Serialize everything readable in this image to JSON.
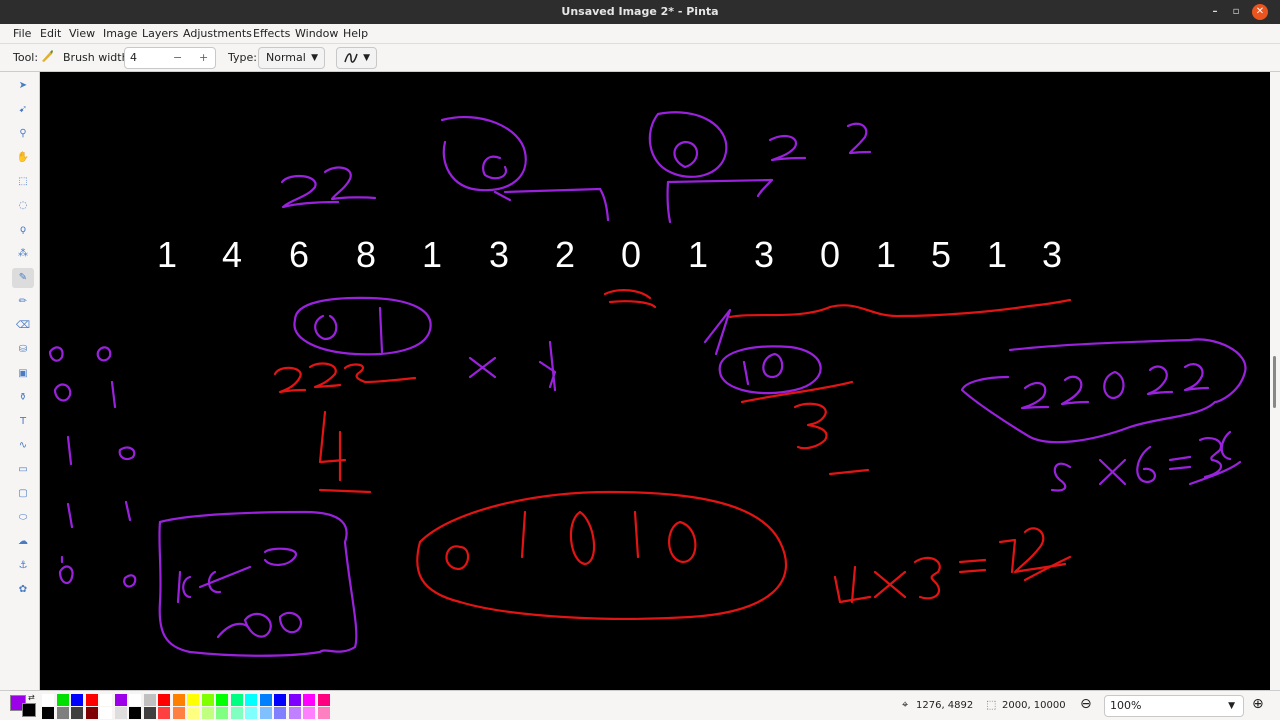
{
  "window": {
    "title": "Unsaved Image 2* - Pinta"
  },
  "menu": {
    "items": [
      "File",
      "Edit",
      "View",
      "Image",
      "Layers",
      "Adjustments",
      "Effects",
      "Window",
      "Help"
    ]
  },
  "toolbar": {
    "tool_label": "Tool:",
    "brush_width_label": "Brush width:",
    "brush_width_value": "4",
    "minus_label": "−",
    "plus_label": "+",
    "type_label": "Type:",
    "type_value": "Normal"
  },
  "tools": [
    {
      "name": "move-selected-tool",
      "icon": "arrow-icon"
    },
    {
      "name": "move-selection-tool",
      "icon": "arrow-plus-icon"
    },
    {
      "name": "zoom-tool",
      "icon": "magnifier-icon"
    },
    {
      "name": "pan-tool",
      "icon": "hand-icon"
    },
    {
      "name": "rectangle-select-tool",
      "icon": "dotted-rectangle-icon"
    },
    {
      "name": "ellipse-select-tool",
      "icon": "dotted-ellipse-icon"
    },
    {
      "name": "lasso-select-tool",
      "icon": "lasso-icon"
    },
    {
      "name": "magic-wand-tool",
      "icon": "wand-icon"
    },
    {
      "name": "paintbrush-tool",
      "icon": "brush-icon",
      "active": true
    },
    {
      "name": "pencil-tool",
      "icon": "pencil-icon"
    },
    {
      "name": "eraser-tool",
      "icon": "eraser-icon"
    },
    {
      "name": "paint-bucket-tool",
      "icon": "bucket-icon"
    },
    {
      "name": "gradient-tool",
      "icon": "gradient-icon"
    },
    {
      "name": "color-picker-tool",
      "icon": "eyedropper-icon"
    },
    {
      "name": "text-tool",
      "icon": "text-icon"
    },
    {
      "name": "line-tool",
      "icon": "line-curve-icon"
    },
    {
      "name": "rectangle-tool",
      "icon": "rectangle-icon"
    },
    {
      "name": "rounded-rectangle-tool",
      "icon": "rounded-rectangle-icon"
    },
    {
      "name": "ellipse-tool",
      "icon": "ellipse-icon"
    },
    {
      "name": "freeform-shape-tool",
      "icon": "freeform-icon"
    },
    {
      "name": "clone-stamp-tool",
      "icon": "stamp-icon"
    },
    {
      "name": "recolor-tool",
      "icon": "recolor-icon"
    }
  ],
  "canvas": {
    "digits": [
      "1",
      "4",
      "6",
      "8",
      "1",
      "3",
      "2",
      "0",
      "1",
      "3",
      "0",
      "1",
      "5",
      "1",
      "3"
    ]
  },
  "palette": {
    "primary": "#9b00e8",
    "secondary": "#000000",
    "colors": [
      "#ffffff",
      "#000000",
      "#00e000",
      "#7f7f7f",
      "#0000ff",
      "#3f3f3f",
      "#ff0000",
      "#7f0000",
      "#ffffff",
      "#ffffff",
      "#9b00e8",
      "#dddddd",
      "#ffffff",
      "#000000",
      "#c0c0c0",
      "#404040",
      "#ff0000",
      "#ff4040",
      "#ff8000",
      "#ff8040",
      "#ffff00",
      "#ffff80",
      "#80ff00",
      "#c0ff80",
      "#00ff00",
      "#80ff80",
      "#00ff80",
      "#80ffc0",
      "#00ffff",
      "#80ffff",
      "#0080ff",
      "#80c0ff",
      "#0000ff",
      "#8080ff",
      "#8000ff",
      "#c080ff",
      "#ff00ff",
      "#ff80ff",
      "#ff0080",
      "#ff80c0"
    ]
  },
  "status": {
    "cursor_position": "1276, 4892",
    "image_size": "2000, 10000",
    "zoom": "100%"
  }
}
